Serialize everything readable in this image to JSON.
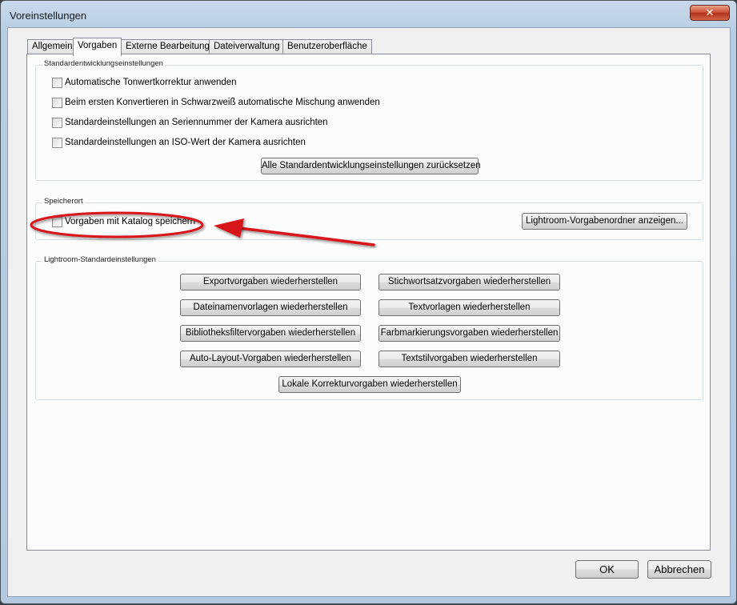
{
  "window": {
    "title": "Voreinstellungen",
    "close_glyph": "✕"
  },
  "tabs": [
    {
      "label": "Allgemein"
    },
    {
      "label": "Vorgaben"
    },
    {
      "label": "Externe Bearbeitung"
    },
    {
      "label": "Dateiverwaltung"
    },
    {
      "label": "Benutzeroberfläche"
    }
  ],
  "active_tab": "Vorgaben",
  "standard": {
    "title": "Standardentwicklungseinstellungen",
    "options": [
      {
        "label": "Automatische Tonwertkorrektur anwenden",
        "checked": false
      },
      {
        "label": "Beim ersten Konvertieren in Schwarzweiß automatische Mischung anwenden",
        "checked": false
      },
      {
        "label": "Standardeinstellungen an Seriennummer der Kamera ausrichten",
        "checked": false
      },
      {
        "label": "Standardeinstellungen an ISO-Wert der Kamera ausrichten",
        "checked": false
      }
    ],
    "reset_button": "Alle Standardentwicklungseinstellungen zurücksetzen"
  },
  "location": {
    "title": "Speicherort",
    "store_with_catalog": {
      "label": "Vorgaben mit Katalog speichern",
      "checked": false
    },
    "show_folder_button": "Lightroom-Vorgabenordner anzeigen..."
  },
  "defaults": {
    "title": "Lightroom-Standardeinstellungen",
    "buttons": [
      "Exportvorgaben wiederherstellen",
      "Stichwortsatzvorgaben wiederherstellen",
      "Dateinamenvorlagen wiederherstellen",
      "Textvorlagen wiederherstellen",
      "Bibliotheksfiltervorgaben wiederherstellen",
      "Farbmarkierungsvorgaben wiederherstellen",
      "Auto-Layout-Vorgaben wiederherstellen",
      "Textstilvorgaben wiederherstellen",
      "Lokale Korrekturvorgaben wiederherstellen"
    ]
  },
  "footer": {
    "ok": "OK",
    "cancel": "Abbrechen"
  },
  "colors": {
    "annotation": "#d7141a",
    "titlebar": "#b8cde2",
    "panel": "#fcfcfc"
  }
}
